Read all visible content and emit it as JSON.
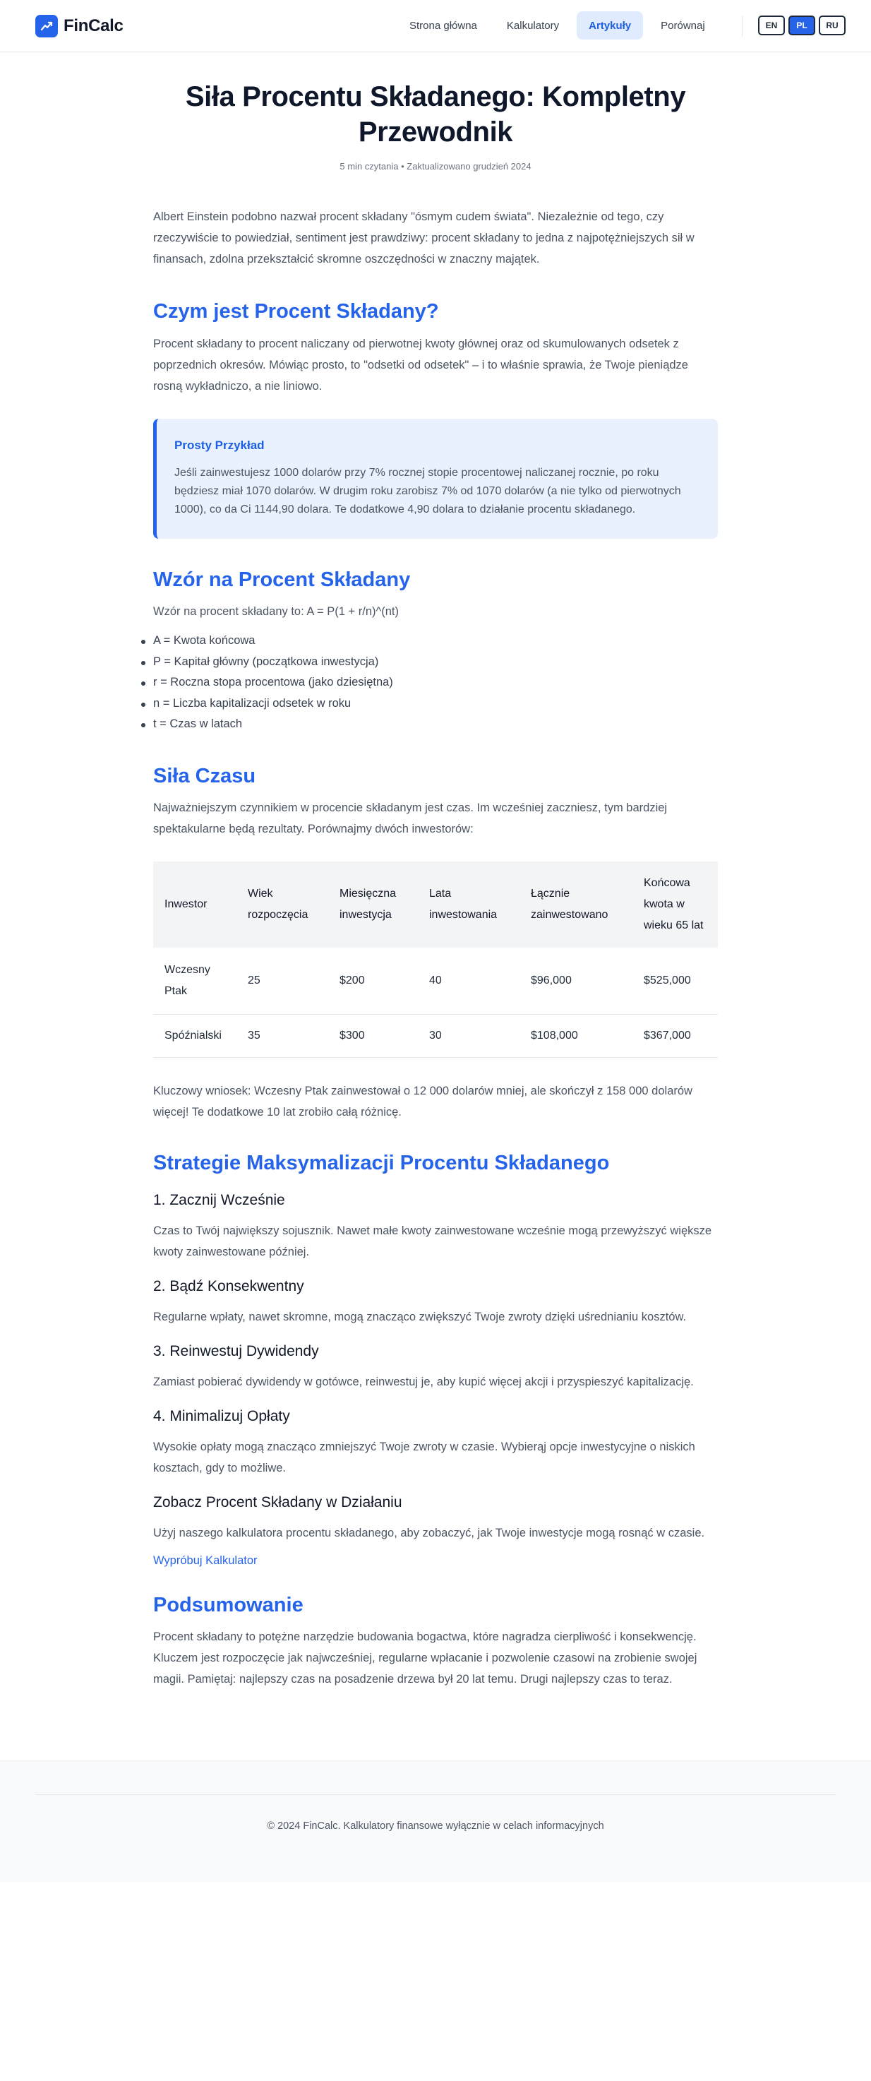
{
  "header": {
    "brand": "FinCalc",
    "nav": [
      "Strona główna",
      "Kalkulatory",
      "Artykuły",
      "Porównaj"
    ],
    "nav_active_index": 2,
    "languages": [
      "EN",
      "PL",
      "RU"
    ],
    "language_active_index": 1,
    "accent_color": "#2563eb"
  },
  "article": {
    "title": "Siła Procentu Składanego: Kompletny Przewodnik",
    "meta": "5 min czytania • Zaktualizowano grudzień 2024",
    "intro": "Albert Einstein podobno nazwał procent składany \"ósmym cudem świata\". Niezależnie od tego, czy rzeczywiście to powiedział, sentiment jest prawdziwy: procent składany to jedna z najpotężniejszych sił w finansach, zdolna przekształcić skromne oszczędności w znaczny majątek.",
    "what_is": {
      "heading": "Czym jest Procent Składany?",
      "text": "Procent składany to procent naliczany od pierwotnej kwoty głównej oraz od skumulowanych odsetek z poprzednich okresów. Mówiąc prosto, to \"odsetki od odsetek\" – i to właśnie sprawia, że Twoje pieniądze rosną wykładniczo, a nie liniowo."
    },
    "example": {
      "title": "Prosty Przykład",
      "text": "Jeśli zainwestujesz 1000 dolarów przy 7% rocznej stopie procentowej naliczanej rocznie, po roku będziesz miał 1070 dolarów. W drugim roku zarobisz 7% od 1070 dolarów (a nie tylko od pierwotnych 1000), co da Ci 1144,90 dolara. Te dodatkowe 4,90 dolara to działanie procentu składanego."
    },
    "formula": {
      "heading": "Wzór na Procent Składany",
      "intro": "Wzór na procent składany to: A = P(1 + r/n)^(nt)",
      "variables": [
        "A = Kwota końcowa",
        "P = Kapitał główny (początkowa inwestycja)",
        "r = Roczna stopa procentowa (jako dziesiętna)",
        "n = Liczba kapitalizacji odsetek w roku",
        "t = Czas w latach"
      ]
    },
    "time": {
      "heading": "Siła Czasu",
      "text": "Najważniejszym czynnikiem w procencie składanym jest czas. Im wcześniej zaczniesz, tym bardziej spektakularne będą rezultaty. Porównajmy dwóch inwestorów:",
      "table": {
        "headers": [
          "Inwestor",
          "Wiek rozpoczęcia",
          "Miesięczna inwestycja",
          "Lata inwestowania",
          "Łącznie zainwestowano",
          "Końcowa kwota w wieku 65 lat"
        ],
        "rows": [
          [
            "Wczesny Ptak",
            "25",
            "$200",
            "40",
            "$96,000",
            "$525,000"
          ],
          [
            "Spóźnialski",
            "35",
            "$300",
            "30",
            "$108,000",
            "$367,000"
          ]
        ]
      },
      "takeaway": "Kluczowy wniosek: Wczesny Ptak zainwestował o 12 000 dolarów mniej, ale skończył z 158 000 dolarów więcej! Te dodatkowe 10 lat zrobiło całą różnicę."
    },
    "strategies": {
      "heading": "Strategie Maksymalizacji Procentu Składanego",
      "items": [
        {
          "title": "1. Zacznij Wcześnie",
          "text": "Czas to Twój największy sojusznik. Nawet małe kwoty zainwestowane wcześnie mogą przewyższyć większe kwoty zainwestowane później."
        },
        {
          "title": "2. Bądź Konsekwentny",
          "text": "Regularne wpłaty, nawet skromne, mogą znacząco zwiększyć Twoje zwroty dzięki uśrednianiu kosztów."
        },
        {
          "title": "3. Reinwestuj Dywidendy",
          "text": "Zamiast pobierać dywidendy w gotówce, reinwestuj je, aby kupić więcej akcji i przyspieszyć kapitalizację."
        },
        {
          "title": "4. Minimalizuj Opłaty",
          "text": "Wysokie opłaty mogą znacząco zmniejszyć Twoje zwroty w czasie. Wybierąj opcje inwestycyjne o niskich kosztach, gdy to możliwe."
        }
      ]
    },
    "action": {
      "title": "Zobacz Procent Składany w Działaniu",
      "text": "Użyj naszego kalkulatora procentu składanego, aby zobaczyć, jak Twoje inwestycje mogą rosnąć w czasie.",
      "link": "Wypróbuj Kalkulator"
    },
    "summary": {
      "heading": "Podsumowanie",
      "text": "Procent składany to potężne narzędzie budowania bogactwa, które nagradza cierpliwość i konsekwencję. Kluczem jest rozpoczęcie jak najwcześniej, regularne wpłacanie i pozwolenie czasowi na zrobienie swojej magii. Pamiętaj: najlepszy czas na posadzenie drzewa był 20 lat temu. Drugi najlepszy czas to teraz."
    }
  },
  "footer": {
    "text": "© 2024 FinCalc. Kalkulatory finansowe wyłącznie w celach informacyjnych"
  }
}
